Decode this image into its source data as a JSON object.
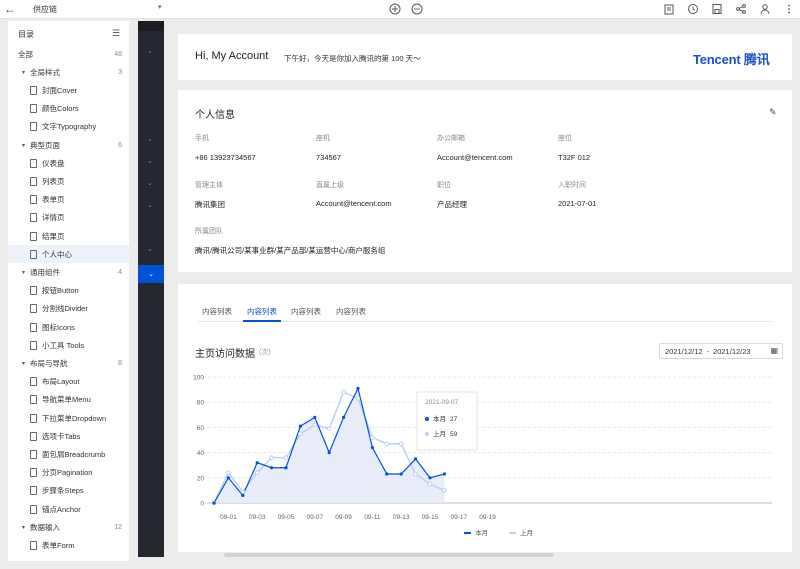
{
  "topbar": {
    "back": "←",
    "title": "供应链",
    "caret": "▾"
  },
  "outline": {
    "heading": "目录",
    "items": [
      {
        "label": "全部",
        "count": "48",
        "level": 0,
        "arrow": ""
      },
      {
        "label": "全局样式",
        "count": "3",
        "level": 0,
        "arrow": "▾"
      },
      {
        "label": "封面Cover",
        "count": "",
        "level": 1,
        "arrow": ""
      },
      {
        "label": "颜色Colors",
        "count": "",
        "level": 1,
        "arrow": ""
      },
      {
        "label": "文字Typography",
        "count": "",
        "level": 1,
        "arrow": ""
      },
      {
        "label": "典型页面",
        "count": "6",
        "level": 0,
        "arrow": "▾"
      },
      {
        "label": "仪表盘",
        "count": "",
        "level": 1,
        "arrow": ""
      },
      {
        "label": "列表页",
        "count": "",
        "level": 1,
        "arrow": ""
      },
      {
        "label": "表单页",
        "count": "",
        "level": 1,
        "arrow": ""
      },
      {
        "label": "详情页",
        "count": "",
        "level": 1,
        "arrow": ""
      },
      {
        "label": "结果页",
        "count": "",
        "level": 1,
        "arrow": ""
      },
      {
        "label": "个人中心",
        "count": "",
        "level": 1,
        "arrow": "",
        "selected": true
      },
      {
        "label": "通用组件",
        "count": "4",
        "level": 0,
        "arrow": "▾"
      },
      {
        "label": "按钮Button",
        "count": "",
        "level": 1,
        "arrow": ""
      },
      {
        "label": "分割线Divider",
        "count": "",
        "level": 1,
        "arrow": ""
      },
      {
        "label": "图标Icons",
        "count": "",
        "level": 1,
        "arrow": ""
      },
      {
        "label": "小工具 Tools",
        "count": "",
        "level": 1,
        "arrow": ""
      },
      {
        "label": "布局与导航",
        "count": "8",
        "level": 0,
        "arrow": "▾"
      },
      {
        "label": "布局Layout",
        "count": "",
        "level": 1,
        "arrow": ""
      },
      {
        "label": "导航菜单Menu",
        "count": "",
        "level": 1,
        "arrow": ""
      },
      {
        "label": "下拉菜单Dropdown",
        "count": "",
        "level": 1,
        "arrow": ""
      },
      {
        "label": "选项卡Tabs",
        "count": "",
        "level": 1,
        "arrow": ""
      },
      {
        "label": "面包屑Breadcrumb",
        "count": "",
        "level": 1,
        "arrow": ""
      },
      {
        "label": "分页Pagination",
        "count": "",
        "level": 1,
        "arrow": ""
      },
      {
        "label": "步骤条Steps",
        "count": "",
        "level": 1,
        "arrow": ""
      },
      {
        "label": "锚点Anchor",
        "count": "",
        "level": 1,
        "arrow": ""
      },
      {
        "label": "数据输入",
        "count": "12",
        "level": 0,
        "arrow": "▾"
      },
      {
        "label": "表单Form",
        "count": "",
        "level": 1,
        "arrow": ""
      }
    ]
  },
  "greeting": {
    "hello": "Hi,  My Account",
    "sub": "下午好，今天是你加入腾讯的第 100 天～",
    "logo": "Tencent 腾讯"
  },
  "profile": {
    "title": "个人信息",
    "fields": [
      {
        "label": "手机",
        "value": "+86 13923734567"
      },
      {
        "label": "座机",
        "value": "734567"
      },
      {
        "label": "办公邮箱",
        "value": "Account@tencent.com"
      },
      {
        "label": "座位",
        "value": "T32F 012"
      },
      {
        "label": "管理主体",
        "value": "腾讯集团"
      },
      {
        "label": "直属上级",
        "value": "Account@tencent.com"
      },
      {
        "label": "职位",
        "value": "产品经理"
      },
      {
        "label": "入职时间",
        "value": "2021-07-01"
      },
      {
        "label": "所属团队",
        "value": "腾讯/腾讯公司/某事业群/某产品部/某运营中心/商户服务组"
      }
    ]
  },
  "tabs": [
    "内容列表",
    "内容列表",
    "内容列表",
    "内容列表"
  ],
  "active_tab": 1,
  "visit": {
    "title": "主页访问数据",
    "unit": "(次)",
    "date_start": "2021/12/12",
    "date_sep": "-",
    "date_end": "2021/12/23"
  },
  "tooltip": {
    "date": "2021-09-07",
    "rows": [
      {
        "name": "本月",
        "value": "27"
      },
      {
        "name": "上月",
        "value": "59"
      }
    ]
  },
  "colors": {
    "primary": "#0052d9",
    "secondary": "#bcd0f5",
    "area": "#e6ebf8"
  },
  "chart_data": {
    "type": "area",
    "title": "主页访问数据",
    "unit": "(次)",
    "x_ticks": [
      "09-01",
      "09-03",
      "09-05",
      "09-07",
      "09-09",
      "09-11",
      "09-13",
      "09-15",
      "09-17",
      "09-19"
    ],
    "x_all": [
      "08-31",
      "09-01",
      "09-02",
      "09-03",
      "09-04",
      "09-05",
      "09-06",
      "09-07",
      "09-08",
      "09-09",
      "09-10",
      "09-11",
      "09-12",
      "09-13",
      "09-14",
      "09-15",
      "09-16"
    ],
    "ylim": [
      0,
      100
    ],
    "yticks": [
      0,
      20,
      40,
      60,
      80,
      100
    ],
    "series": [
      {
        "name": "本月",
        "values": [
          0,
          20,
          6,
          32,
          28,
          28,
          61,
          68,
          40,
          68,
          91,
          44,
          23,
          23,
          35,
          20,
          23
        ]
      },
      {
        "name": "上月",
        "values": [
          0,
          24,
          9,
          24,
          36,
          36,
          55,
          62,
          59,
          88,
          83,
          52,
          47,
          47,
          23,
          15,
          10
        ]
      }
    ],
    "legend": [
      "本月",
      "上月"
    ],
    "grid": true
  }
}
